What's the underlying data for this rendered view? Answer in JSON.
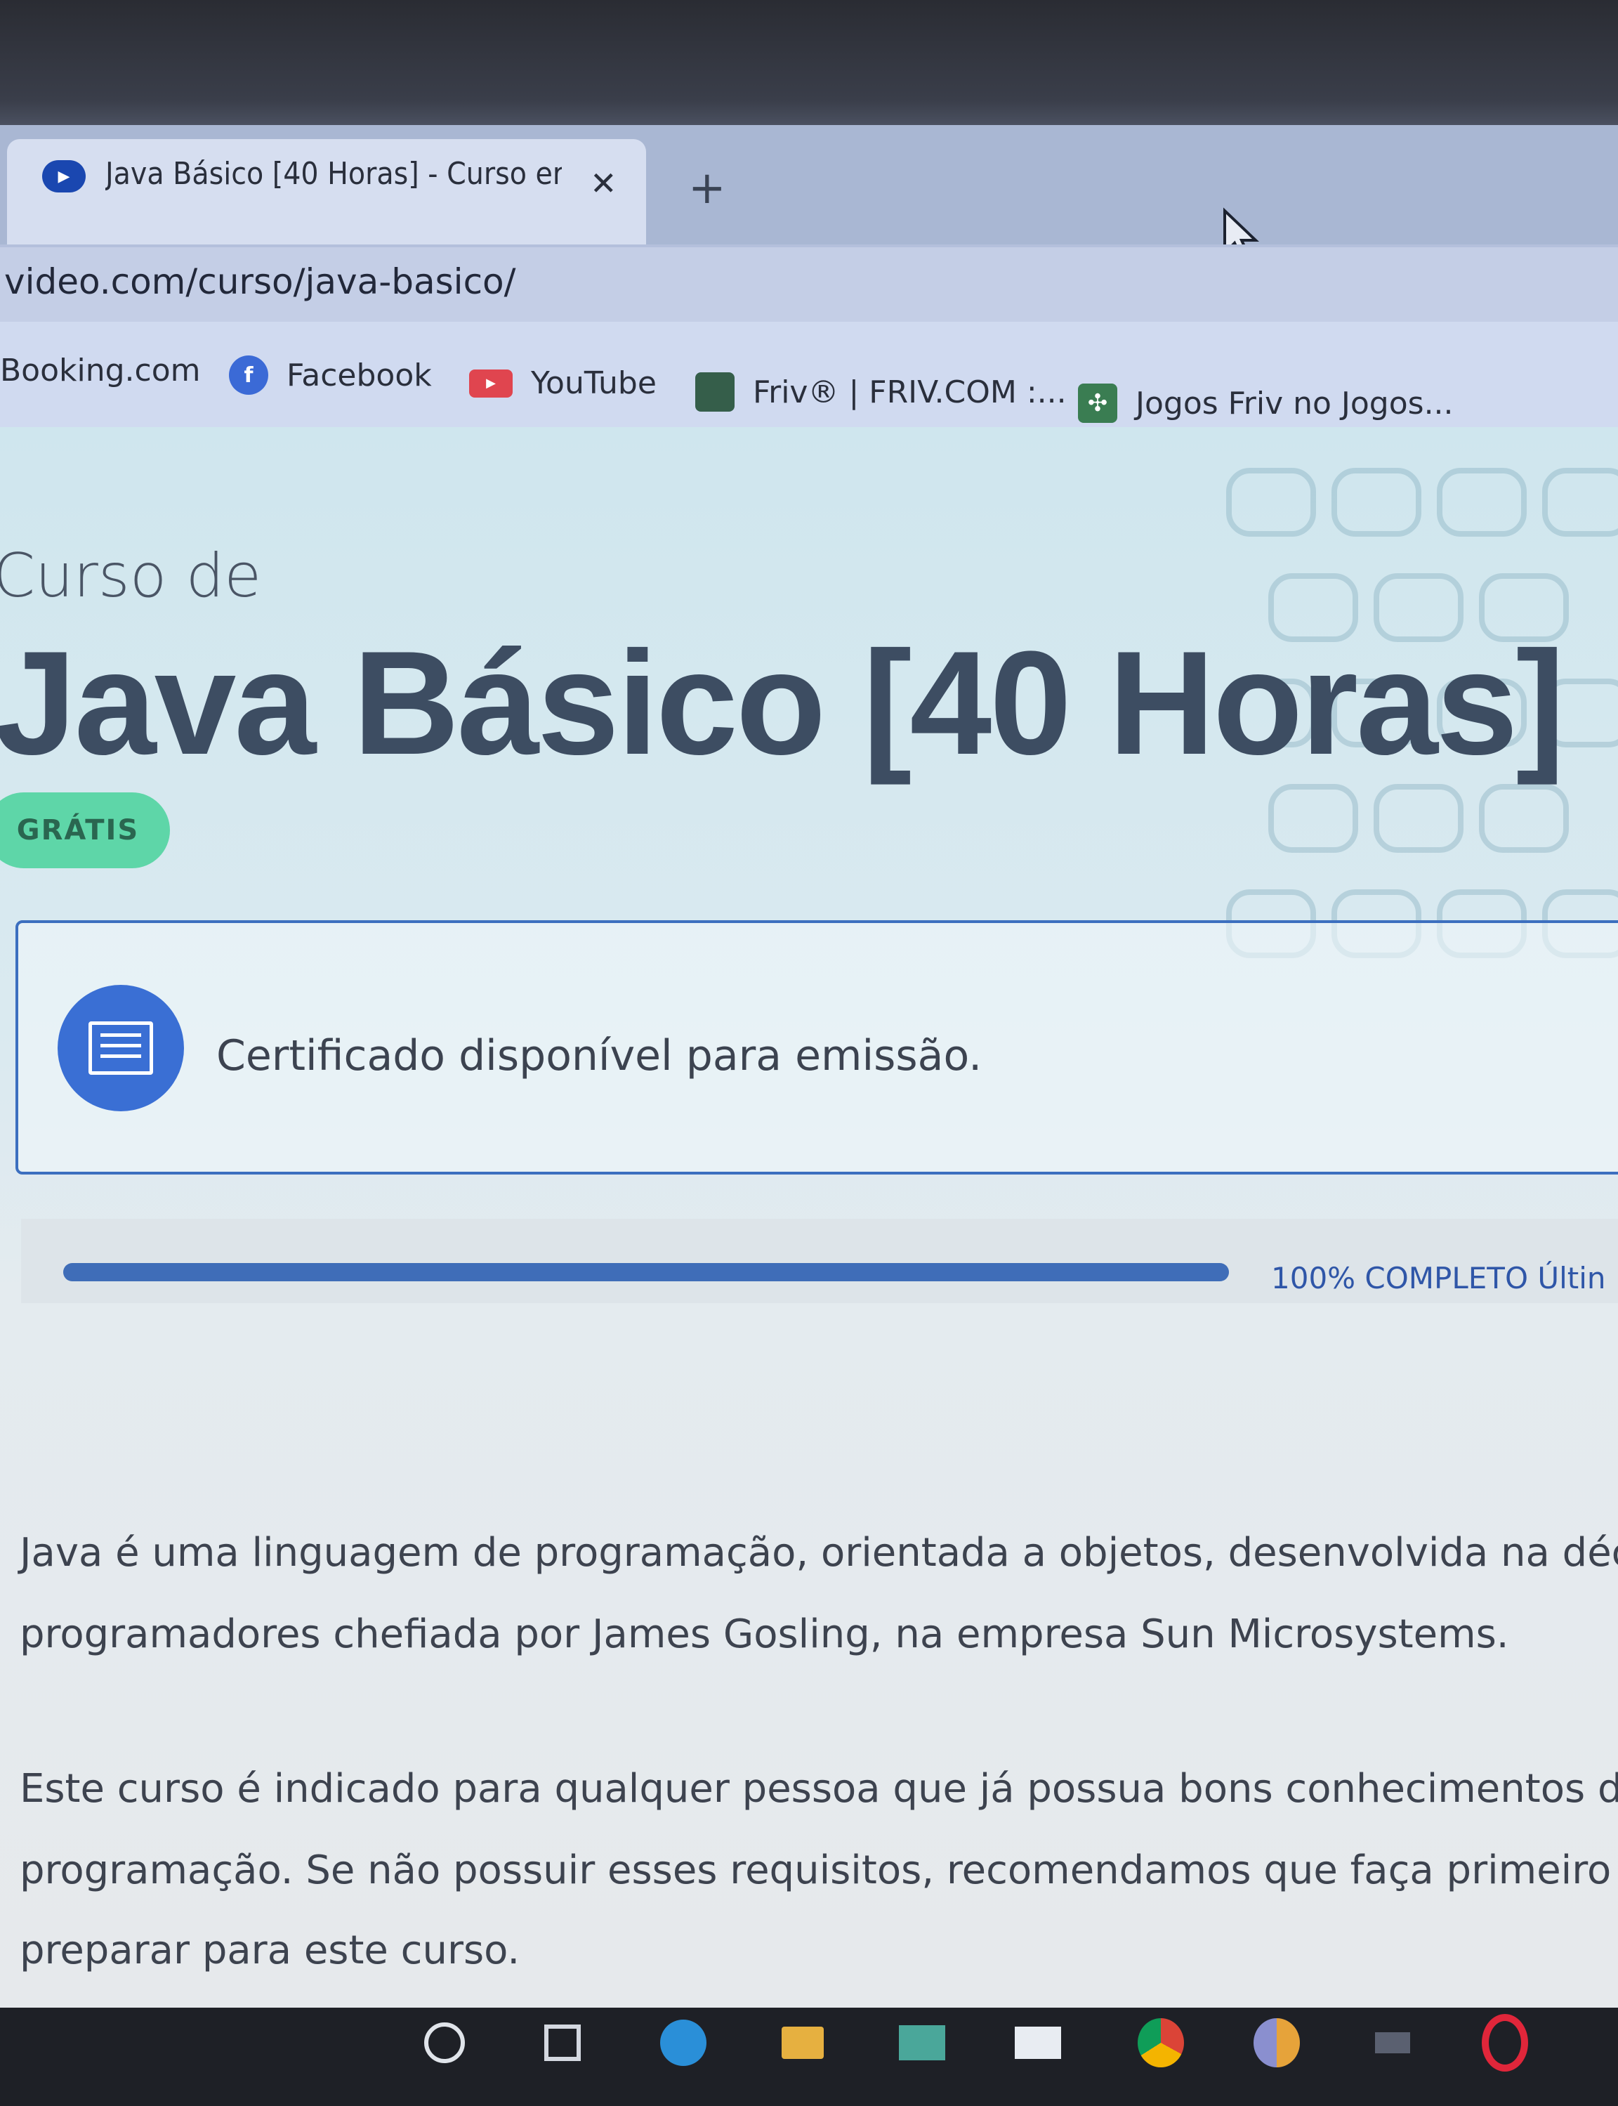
{
  "browser": {
    "tab": {
      "title": "Java Básico [40 Horas] - Curso er",
      "close_label": "✕"
    },
    "new_tab_label": "+",
    "url": "video.com/curso/java-basico/",
    "bookmarks": [
      {
        "label": "Booking.com",
        "icon": "none"
      },
      {
        "label": "Facebook",
        "icon": "facebook-icon",
        "color": "#3b6ad6"
      },
      {
        "label": "YouTube",
        "icon": "youtube-icon",
        "color": "#e0454f"
      },
      {
        "label": "Friv® | FRIV.COM :...",
        "icon": "friv-icon",
        "color": "#355e4a"
      },
      {
        "label": "Jogos Friv no Jogos...",
        "icon": "jogos-icon",
        "color": "#3a7d52"
      }
    ]
  },
  "course": {
    "pre_title": "Curso de",
    "title": "Java Básico [40 Horas]",
    "badge": "GRÁTIS",
    "certificate_text": "Certificado disponível para emissão.",
    "progress_percent": 100,
    "progress_label": "100% COMPLETO Últin"
  },
  "description": {
    "lines": [
      "Java é uma linguagem de programação, orientada a objetos, desenvolvida na déc",
      "programadores chefiada por James Gosling, na empresa Sun Microsystems.",
      "Este curso é indicado para qualquer pessoa que já possua bons conhecimentos de a",
      "programação. Se não possuir esses requisitos, recomendamos que faça primeiro o C",
      "preparar para este curso."
    ]
  },
  "colors": {
    "accent": "#3a6fd4",
    "badge": "#5ed6a8",
    "title": "#3d4d62",
    "progress": "#3f6db8"
  },
  "taskbar": {
    "icons": [
      "search-icon",
      "task-view-icon",
      "edge-icon",
      "file-explorer-icon",
      "store-icon",
      "mail-icon",
      "chrome-icon",
      "chrome-canary-icon",
      "app-icon",
      "opera-icon"
    ]
  }
}
